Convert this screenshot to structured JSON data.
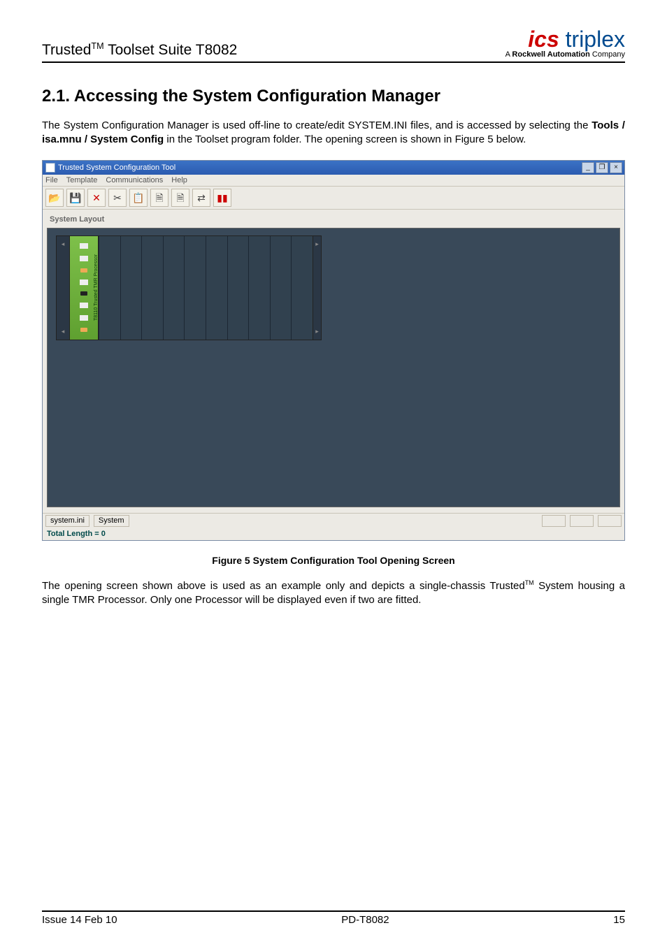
{
  "header": {
    "product_line_prefix": "Trusted",
    "product_line_suffix": " Toolset Suite T8082",
    "brand_ics": "ics",
    "brand_triplex": " triplex",
    "tagline_prefix": "A ",
    "tagline_bold": "Rockwell Automation",
    "tagline_suffix": " Company"
  },
  "section": {
    "number": "2.1.",
    "title": " Accessing the System Configuration Manager"
  },
  "para1_a": "The System Configuration Manager is used off-line to create/edit SYSTEM.INI files, and is accessed by selecting the ",
  "para1_b": "Tools / isa.mnu / System Config",
  "para1_c": " in the Toolset program folder.  The opening screen is shown in Figure 5 below.",
  "app": {
    "title": "Trusted System Configuration Tool",
    "menu": {
      "file": "File",
      "template": "Template",
      "comms": "Communications",
      "help": "Help"
    },
    "layout_label": "System Layout",
    "module_label": "T8110 Trusted TMR Processor",
    "status": {
      "file": "system.ini",
      "system": "System",
      "length": "Total Length = 0"
    },
    "win_buttons": {
      "min": "_",
      "max": "❐",
      "close": "×"
    }
  },
  "figure": {
    "caption": "Figure 5 System Configuration Tool Opening Screen"
  },
  "para2_a": "The opening screen shown above is used as an example only and depicts a single-chassis Trusted",
  "para2_b": " System housing a single TMR Processor.  Only one Processor will be displayed even if two are fitted.",
  "footer": {
    "left": "Issue 14 Feb 10",
    "center": "PD-T8082",
    "right": "15"
  }
}
